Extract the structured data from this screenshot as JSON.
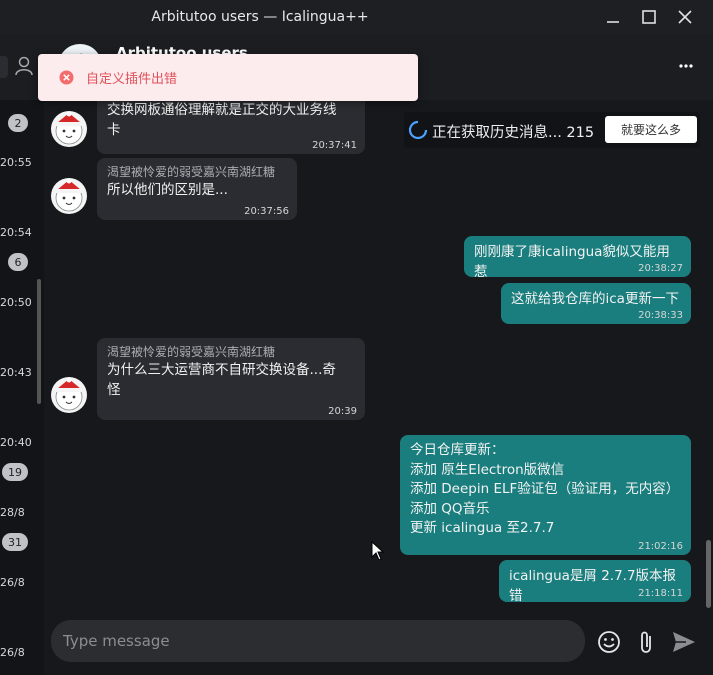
{
  "window": {
    "title": "Arbitutoo users — Icalingua++"
  },
  "header": {
    "chat_name": "Arbitutoo users"
  },
  "toast": {
    "message": "自定义插件出错"
  },
  "loading": {
    "text": "正在获取历史消息... 215",
    "button_label": "就要这么多"
  },
  "sidebar": {
    "badges": [
      "2",
      "6",
      "19",
      "31"
    ],
    "times": [
      "20:55",
      "20:54",
      "20:50",
      "20:43",
      "20:40",
      "28/8",
      "26/8",
      "26/8"
    ]
  },
  "messages": [
    {
      "direction": "in",
      "sender": "",
      "text": "交换网板通俗理解就是正交的大业务线\n卡",
      "time": "20:37:41"
    },
    {
      "direction": "in",
      "sender": "渴望被怜爱的弱受嘉兴南湖红糖",
      "text": "所以他们的区别是...",
      "time": "20:37:56"
    },
    {
      "direction": "out",
      "text": "刚刚康了康icalingua貌似又能用惹",
      "time": "20:38:27"
    },
    {
      "direction": "out",
      "text": "这就给我仓库的ica更新一下",
      "time": "20:38:33"
    },
    {
      "direction": "in",
      "sender": "渴望被怜爱的弱受嘉兴南湖红糖",
      "text": "为什么三大运营商不自研交换设备...奇\n怪",
      "time": "20:39"
    },
    {
      "direction": "out",
      "text": "今日仓库更新：\n添加 原生Electron版微信\n添加 Deepin ELF验证包（验证用，无内容）\n添加 QQ音乐\n更新 icalingua 至2.7.7",
      "time": "21:02:16"
    },
    {
      "direction": "out",
      "text": "icalingua是屑 2.7.7版本报错",
      "time": "21:18:11"
    }
  ],
  "composer": {
    "placeholder": "Type message"
  },
  "colors": {
    "outgoing_bubble": "#1b7e7e",
    "incoming_bubble": "#2a2c31",
    "toast_bg": "#fdeced",
    "toast_text": "#e0515b"
  }
}
